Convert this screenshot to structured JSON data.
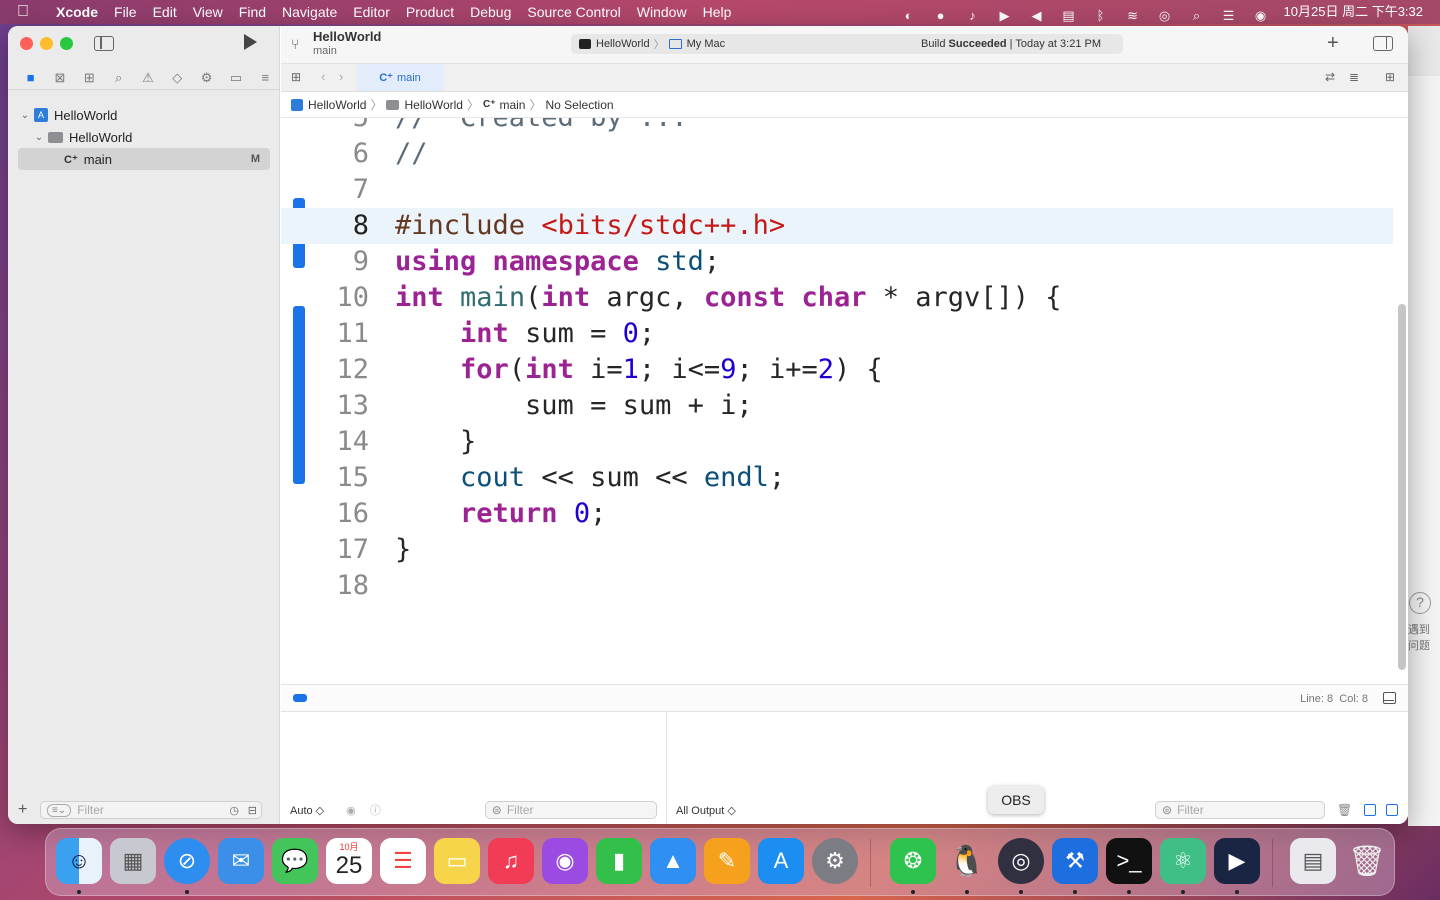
{
  "menubar": {
    "app": "Xcode",
    "items": [
      "File",
      "Edit",
      "View",
      "Find",
      "Navigate",
      "Editor",
      "Product",
      "Debug",
      "Source Control",
      "Window",
      "Help"
    ],
    "datetime": "10月25日 周二 下午3:32"
  },
  "toolbar": {
    "project": "HelloWorld",
    "branch": "main",
    "scheme": "HelloWorld",
    "destination": "My Mac",
    "status_prefix": "Build ",
    "status_bold": "Succeeded",
    "status_suffix": " | Today at 3:21 PM"
  },
  "tab": {
    "label": "main"
  },
  "jumpbar": {
    "items": [
      "HelloWorld",
      "HelloWorld",
      "main",
      "No Selection"
    ]
  },
  "navigator": {
    "items": [
      {
        "label": "HelloWorld",
        "level": 0
      },
      {
        "label": "HelloWorld",
        "level": 1
      },
      {
        "label": "main",
        "level": 2,
        "badge": "M"
      }
    ],
    "filter_placeholder": "Filter"
  },
  "editor": {
    "current_line": 8,
    "lines": [
      {
        "n": "6",
        "code": "//"
      },
      {
        "n": "7",
        "code": ""
      },
      {
        "n": "8",
        "code": "#include <bits/stdc++.h>"
      },
      {
        "n": "9",
        "code": "using namespace std;"
      },
      {
        "n": "10",
        "code": "int main(int argc, const char * argv[]) {"
      },
      {
        "n": "11",
        "code": "    int sum = 0;"
      },
      {
        "n": "12",
        "code": "    for(int i=1; i<=9; i+=2) {"
      },
      {
        "n": "13",
        "code": "        sum = sum + i;"
      },
      {
        "n": "14",
        "code": "    }"
      },
      {
        "n": "15",
        "code": "    cout << sum << endl;"
      },
      {
        "n": "16",
        "code": "    return 0;"
      },
      {
        "n": "17",
        "code": "}"
      },
      {
        "n": "18",
        "code": ""
      }
    ]
  },
  "statusbar": {
    "position": "Line: 8  Col: 8"
  },
  "debug": {
    "variables_scope": "Auto ◇",
    "filter_placeholder": "Filter",
    "output_selector": "All Output ◇",
    "console_filter_placeholder": "Filter"
  },
  "dock": {
    "tooltip": "OBS",
    "calendar_month": "10月",
    "calendar_day": "25"
  },
  "peek_window": {
    "text": "遇到\n问题"
  }
}
